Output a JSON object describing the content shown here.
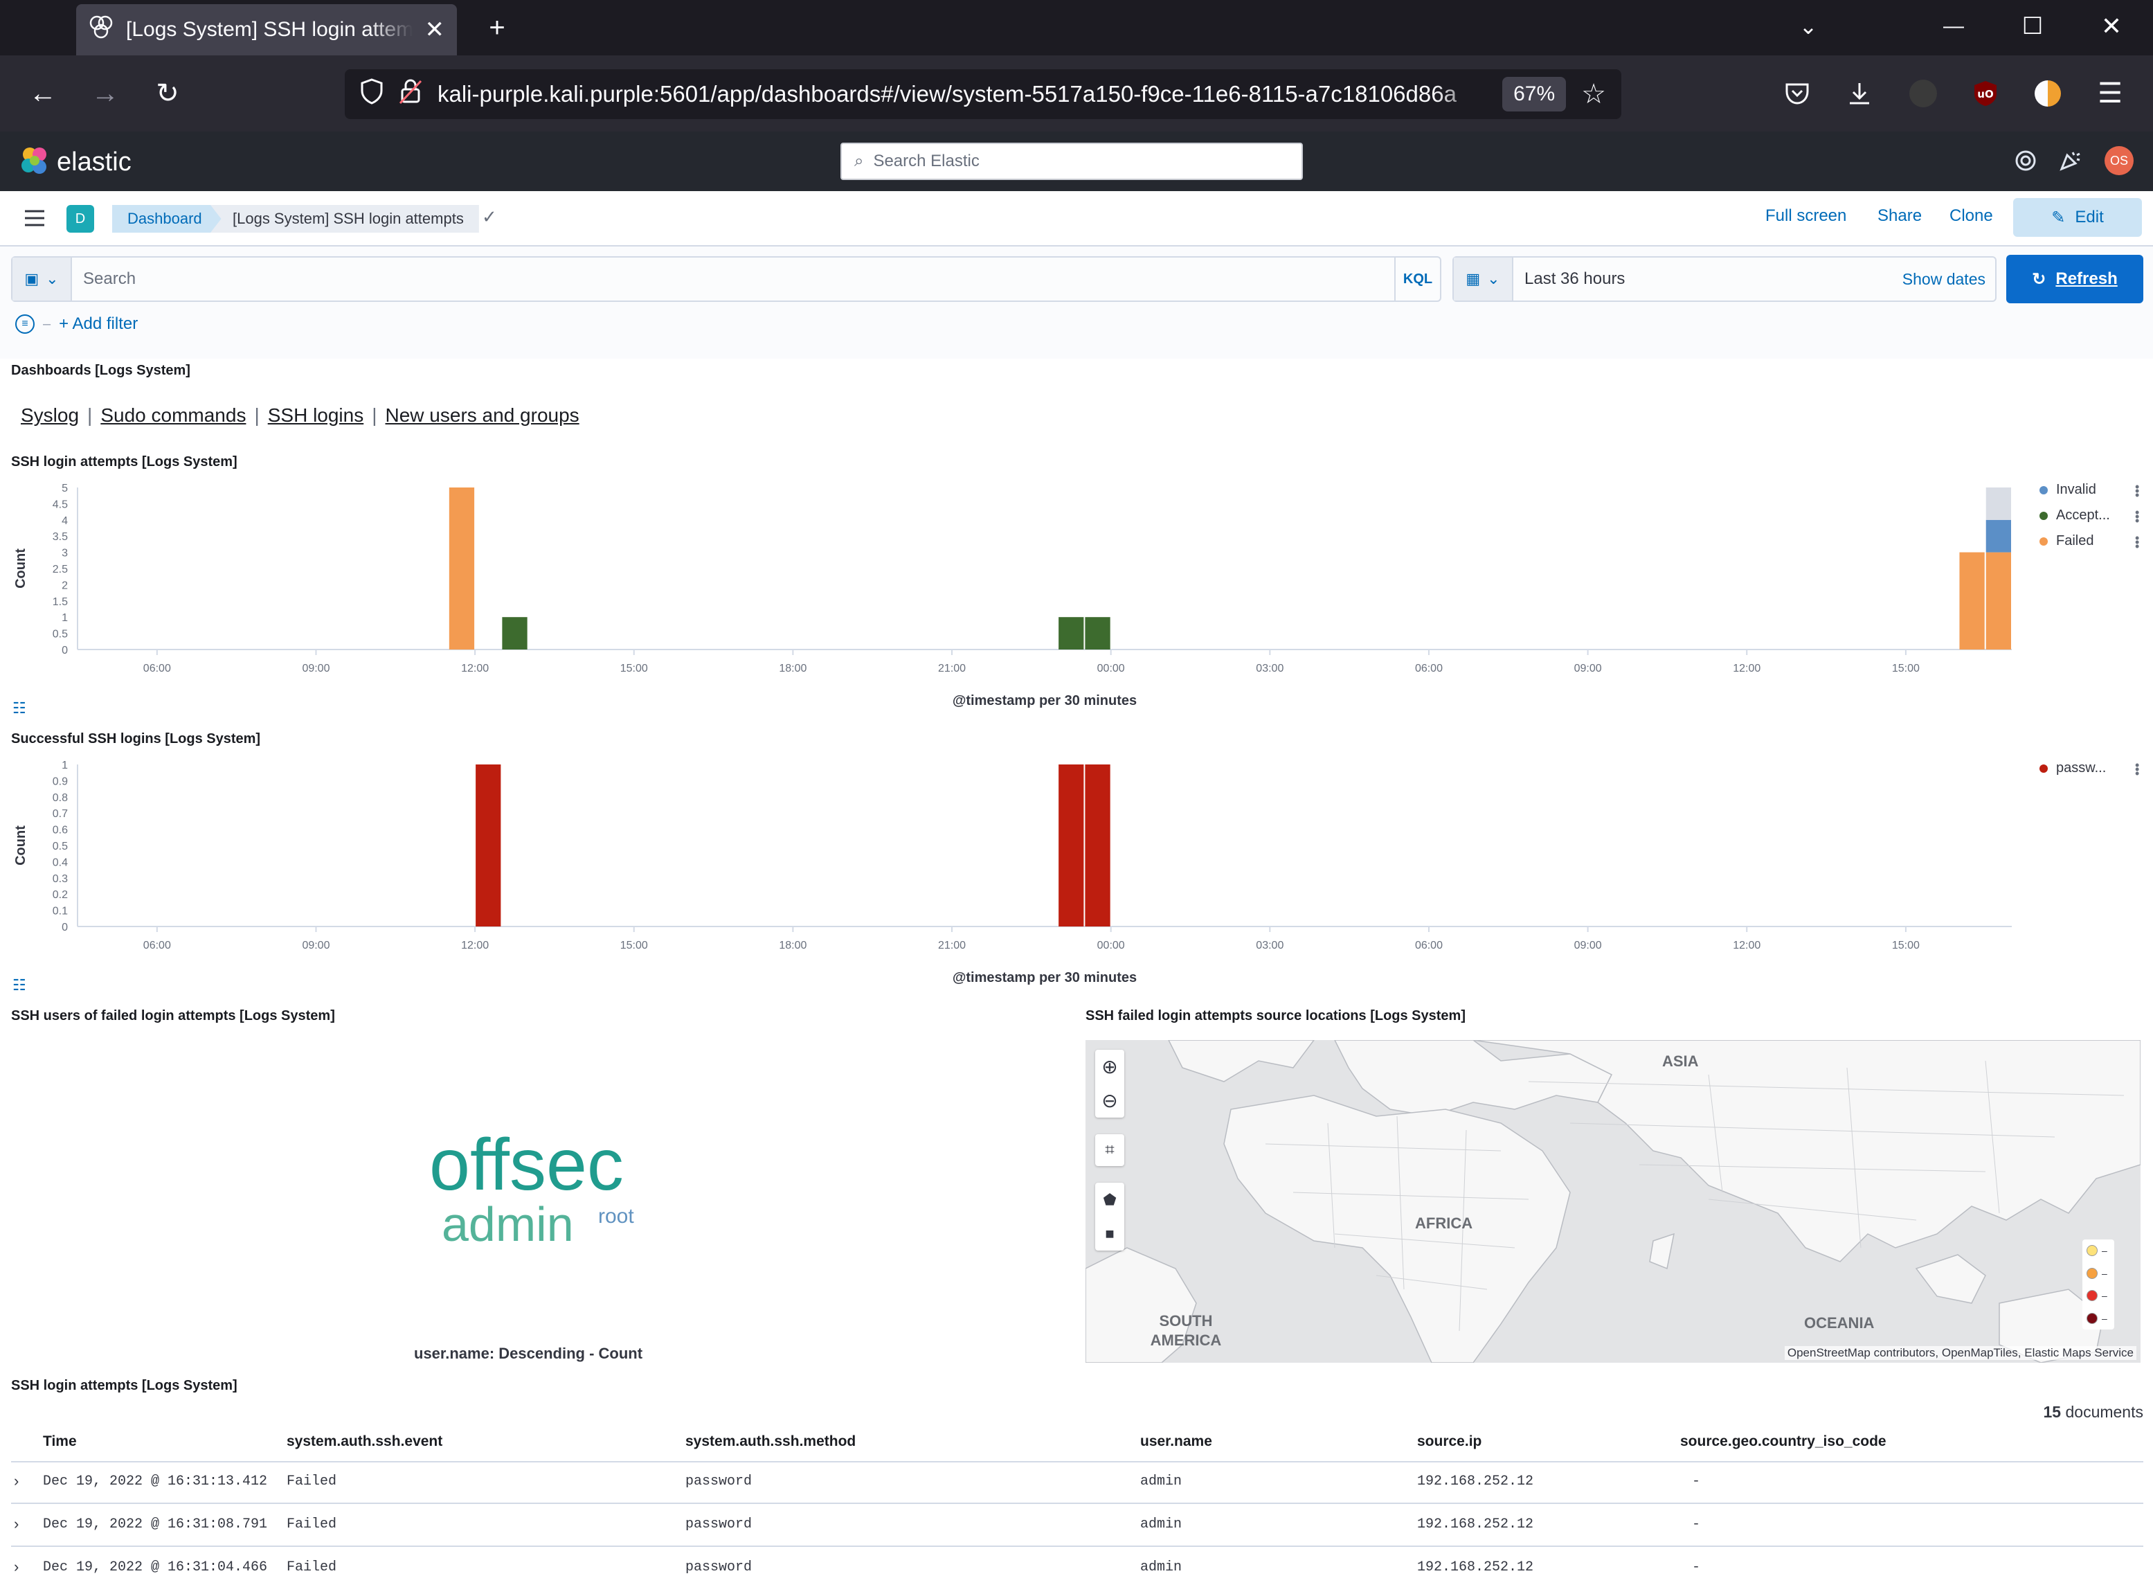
{
  "browser": {
    "tab_title": "[Logs System] SSH login attempts",
    "url": "kali-purple.kali.purple:5601/app/dashboards#/view/system-5517a150-f9ce-11e6-8115-a7c18106d86a",
    "zoom": "67%"
  },
  "kibana": {
    "brand": "elastic",
    "search_placeholder": "Search Elastic",
    "avatar_initials": "OS",
    "space_initial": "D",
    "breadcrumbs": [
      "Dashboard",
      "[Logs System] SSH login attempts"
    ],
    "header_links": [
      "Full screen",
      "Share",
      "Clone"
    ],
    "edit_label": "Edit"
  },
  "query": {
    "placeholder": "Search",
    "language": "KQL",
    "time_range": "Last 36 hours",
    "show_dates": "Show dates",
    "refresh": "Refresh",
    "add_filter": "+ Add filter"
  },
  "nav_panel": {
    "title": "Dashboards [Logs System]",
    "links": [
      "Syslog",
      "Sudo commands",
      "SSH logins",
      "New users and groups"
    ]
  },
  "chart_data": [
    {
      "type": "bar",
      "title": "SSH login attempts [Logs System]",
      "ylabel": "Count",
      "xlabel": "@timestamp per 30 minutes",
      "ylim": [
        0,
        5
      ],
      "yticks": [
        "0",
        "0.5",
        "1",
        "1.5",
        "2",
        "2.5",
        "3",
        "3.5",
        "4",
        "4.5",
        "5"
      ],
      "xticks": [
        "06:00",
        "09:00",
        "12:00",
        "15:00",
        "18:00",
        "21:00",
        "00:00",
        "03:00",
        "06:00",
        "09:00",
        "12:00",
        "15:00"
      ],
      "legend": [
        {
          "name": "Invalid",
          "color": "#5b8fc7"
        },
        {
          "name": "Accept...",
          "color": "#3d6b2e"
        },
        {
          "name": "Failed",
          "color": "#f39b51"
        }
      ],
      "bars": [
        {
          "time": "11:30",
          "series": "Failed",
          "value": 5
        },
        {
          "time": "12:30",
          "series": "Accepted",
          "value": 1
        },
        {
          "time": "23:00",
          "series": "Accepted",
          "value": 1
        },
        {
          "time": "23:30",
          "series": "Accepted",
          "value": 1
        },
        {
          "time": "16:00",
          "series": "Failed",
          "value": 3
        },
        {
          "time": "16:30",
          "series": "Failed",
          "value": 3
        },
        {
          "time": "16:30",
          "series": "Invalid",
          "value": 1
        },
        {
          "time": "16:30",
          "series": "Other",
          "value": 1
        }
      ]
    },
    {
      "type": "bar",
      "title": "Successful SSH logins [Logs System]",
      "ylabel": "Count",
      "xlabel": "@timestamp per 30 minutes",
      "ylim": [
        0,
        1
      ],
      "yticks": [
        "0",
        "0.1",
        "0.2",
        "0.3",
        "0.4",
        "0.5",
        "0.6",
        "0.7",
        "0.8",
        "0.9",
        "1"
      ],
      "xticks": [
        "06:00",
        "09:00",
        "12:00",
        "15:00",
        "18:00",
        "21:00",
        "00:00",
        "03:00",
        "06:00",
        "09:00",
        "12:00",
        "15:00"
      ],
      "legend": [
        {
          "name": "passw...",
          "color": "#bd1e0f"
        }
      ],
      "bars": [
        {
          "time": "12:00",
          "series": "password",
          "value": 1
        },
        {
          "time": "23:00",
          "series": "password",
          "value": 1
        },
        {
          "time": "23:30",
          "series": "password",
          "value": 1
        }
      ]
    }
  ],
  "wordcloud": {
    "title": "SSH users of failed login attempts [Logs System]",
    "words": [
      {
        "text": "offsec",
        "color": "#209c8e"
      },
      {
        "text": "admin",
        "color": "#54b399"
      },
      {
        "text": "root",
        "color": "#6092c0"
      }
    ],
    "caption": "user.name: Descending - Count"
  },
  "map": {
    "title": "SSH failed login attempts source locations [Logs System]",
    "labels": [
      "ASIA",
      "AFRICA",
      "SOUTH AMERICA",
      "OCEANIA"
    ],
    "attribution": "OpenStreetMap contributors, OpenMapTiles, Elastic Maps Service",
    "legend": [
      {
        "label": "–",
        "color": "#fde27a"
      },
      {
        "label": "–",
        "color": "#f6a140"
      },
      {
        "label": "–",
        "color": "#e3322b"
      },
      {
        "label": "–",
        "color": "#7a0b14"
      }
    ]
  },
  "table": {
    "title": "SSH login attempts [Logs System]",
    "doc_count": "15",
    "doc_label": "documents",
    "columns": [
      "Time",
      "system.auth.ssh.event",
      "system.auth.ssh.method",
      "user.name",
      "source.ip",
      "source.geo.country_iso_code"
    ],
    "rows": [
      [
        "Dec 19, 2022 @ 16:31:13.412",
        "Failed",
        "password",
        "admin",
        "192.168.252.12",
        "-"
      ],
      [
        "Dec 19, 2022 @ 16:31:08.791",
        "Failed",
        "password",
        "admin",
        "192.168.252.12",
        "-"
      ],
      [
        "Dec 19, 2022 @ 16:31:04.466",
        "Failed",
        "password",
        "admin",
        "192.168.252.12",
        "-"
      ]
    ]
  }
}
